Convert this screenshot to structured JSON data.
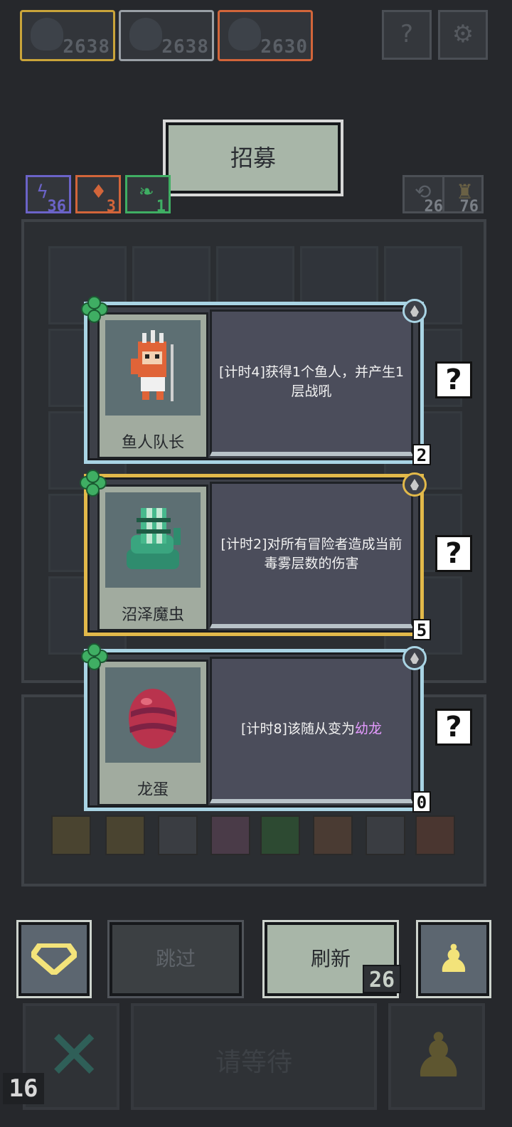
{
  "top_resources": [
    {
      "value": "2638",
      "border": "#c9a43a"
    },
    {
      "value": "2638",
      "border": "#9aa0a6"
    },
    {
      "value": "2630",
      "border": "#d2653a"
    }
  ],
  "recruit_title": "招募",
  "stats_left": [
    {
      "value": "36",
      "color": "#6b63c8",
      "icon": "lightning-icon"
    },
    {
      "value": "3",
      "color": "#d2653a",
      "icon": "flame-icon"
    },
    {
      "value": "1",
      "color": "#3fae63",
      "icon": "leaf-icon"
    }
  ],
  "stats_right": [
    {
      "value": "26",
      "icon": "refresh-icon"
    },
    {
      "value": "76",
      "icon": "key-icon"
    }
  ],
  "cards": [
    {
      "name": "鱼人队长",
      "desc": "[计时4]获得1个鱼人，并产生1层战吼",
      "tier": "2",
      "frame": "#a9d4e4"
    },
    {
      "name": "沼泽魔虫",
      "desc": "[计时2]对所有冒险者造成当前毒雾层数的伤害",
      "tier": "5",
      "frame": "#e2b94a"
    },
    {
      "name": "龙蛋",
      "desc_pre": "[计时8]该随从变为",
      "desc_highlight": "幼龙",
      "highlight_color": "#e59bff",
      "tier": "0",
      "frame": "#a9d4e4"
    }
  ],
  "help_mark": "?",
  "buttons": {
    "skip": "跳过",
    "refresh": "刷新",
    "refresh_cost": "26",
    "wait": "请等待"
  },
  "round_number": "16"
}
